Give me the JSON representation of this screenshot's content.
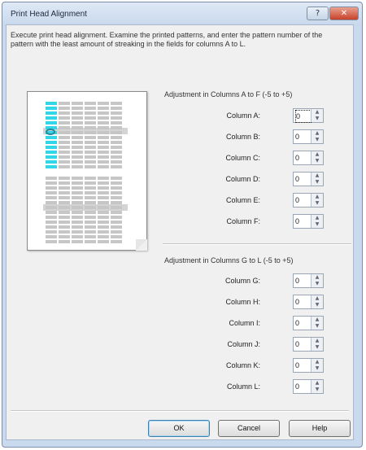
{
  "dialog": {
    "title": "Print Head Alignment",
    "help_glyph": "?",
    "close_glyph": "✕"
  },
  "intro_text": "Execute print head alignment. Examine the printed patterns, and enter the pattern number of the pattern with the least amount of streaking in the fields for columns A to L.",
  "group1": {
    "label": "Adjustment in Columns A to F (-5 to +5)",
    "rows": [
      {
        "label": "Column A:",
        "value": "0"
      },
      {
        "label": "Column B:",
        "value": "0"
      },
      {
        "label": "Column C:",
        "value": "0"
      },
      {
        "label": "Column D:",
        "value": "0"
      },
      {
        "label": "Column E:",
        "value": "0"
      },
      {
        "label": "Column F:",
        "value": "0"
      }
    ]
  },
  "group2": {
    "label": "Adjustment in Columns G to L (-5 to +5)",
    "rows": [
      {
        "label": "Column G:",
        "value": "0"
      },
      {
        "label": "Column H:",
        "value": "0"
      },
      {
        "label": "Column I:",
        "value": "0"
      },
      {
        "label": "Column J:",
        "value": "0"
      },
      {
        "label": "Column K:",
        "value": "0"
      },
      {
        "label": "Column L:",
        "value": "0"
      }
    ]
  },
  "spin_glyphs": {
    "up": "▲",
    "down": "▼"
  },
  "buttons": {
    "ok": "OK",
    "cancel": "Cancel",
    "help": "Help"
  },
  "colors": {
    "accent_cyan": "#33d6e6",
    "pattern_gray": "#c6c6c6"
  }
}
